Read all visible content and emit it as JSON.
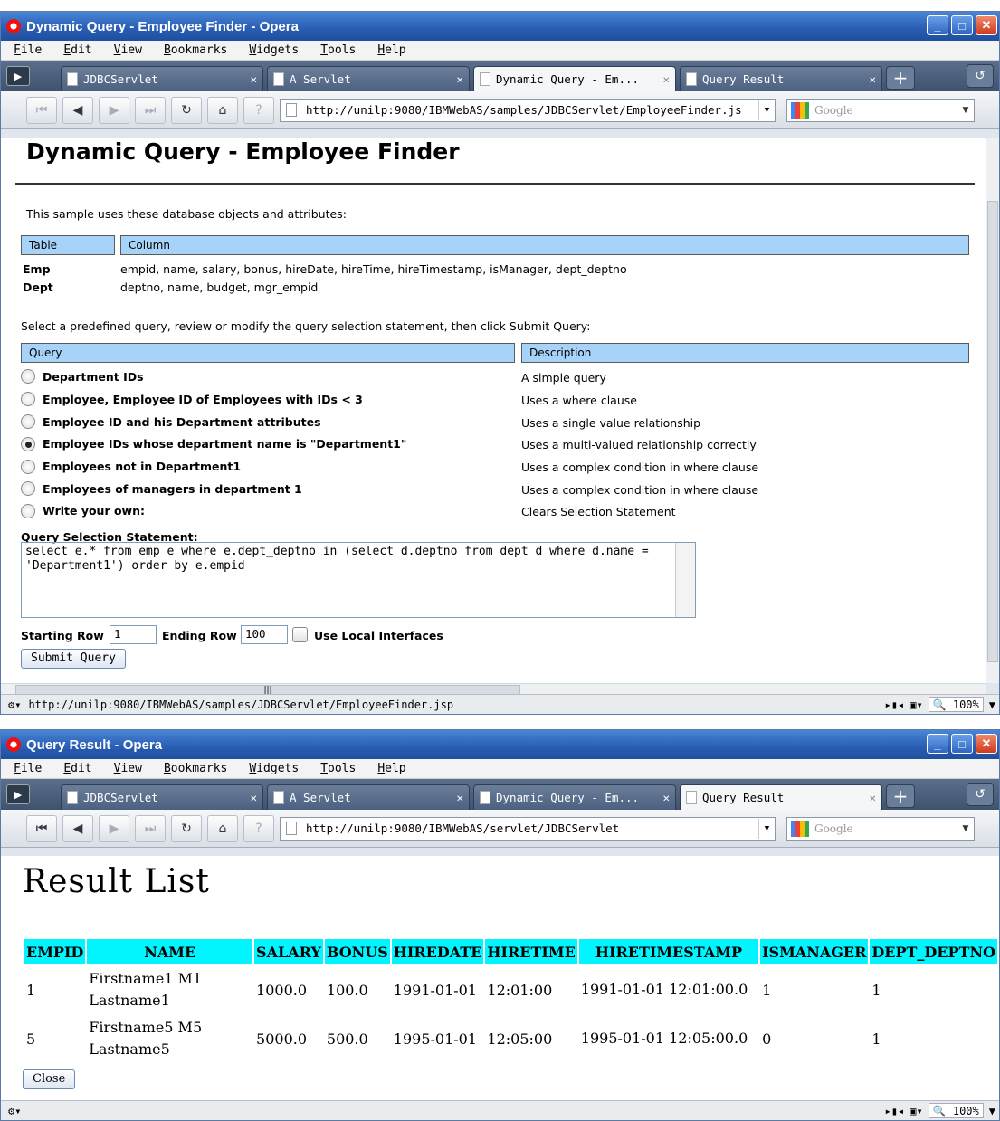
{
  "window1": {
    "title": "Dynamic Query - Employee Finder - Opera",
    "menu": [
      "File",
      "Edit",
      "View",
      "Bookmarks",
      "Widgets",
      "Tools",
      "Help"
    ],
    "tabs": [
      "JDBCServlet",
      "A Servlet",
      "Dynamic Query - Em...",
      "Query Result"
    ],
    "address": "http://unilp:9080/IBMWebAS/samples/JDBCServlet/EmployeeFinder.js",
    "search_placeholder": "Google",
    "status_url": "http://unilp:9080/IBMWebAS/samples/JDBCServlet/EmployeeFinder.jsp",
    "zoom": "100%",
    "page": {
      "heading": "Dynamic Query - Employee Finder",
      "intro": "This sample uses these database objects and attributes:",
      "table_headers": [
        "Table",
        "Column"
      ],
      "tables": [
        {
          "name": "Emp",
          "columns": "empid, name, salary, bonus, hireDate, hireTime, hireTimestamp, isManager, dept_deptno"
        },
        {
          "name": "Dept",
          "columns": "deptno, name, budget, mgr_empid"
        }
      ],
      "select_text": "Select a predefined query, review or modify the query selection statement, then click Submit Query:",
      "query_headers": [
        "Query",
        "Description"
      ],
      "queries": [
        {
          "label": "Department IDs",
          "desc": "A simple query",
          "selected": false
        },
        {
          "label": "Employee, Employee ID of Employees with IDs < 3",
          "desc": "Uses a where clause",
          "selected": false
        },
        {
          "label": "Employee ID and his Department attributes",
          "desc": "Uses a single value relationship",
          "selected": false
        },
        {
          "label": "Employee IDs whose department name is \"Department1\"",
          "desc": "Uses a multi-valued relationship correctly",
          "selected": true
        },
        {
          "label": "Employees not in Department1",
          "desc": "Uses a complex condition in where clause",
          "selected": false
        },
        {
          "label": "Employees of managers in department 1",
          "desc": "Uses a complex condition in where clause",
          "selected": false
        },
        {
          "label": "Write your own:",
          "desc": "Clears Selection Statement",
          "selected": false
        }
      ],
      "statement_label": "Query Selection Statement:",
      "statement": "select e.* from emp e where e.dept_deptno in (select d.deptno from dept d where d.name = 'Department1') order by e.empid",
      "starting_row_label": "Starting Row",
      "starting_row": "1",
      "ending_row_label": "Ending Row",
      "ending_row": "100",
      "local_label": "Use Local Interfaces",
      "submit": "Submit Query"
    }
  },
  "window2": {
    "title": "Query Result - Opera",
    "menu": [
      "File",
      "Edit",
      "View",
      "Bookmarks",
      "Widgets",
      "Tools",
      "Help"
    ],
    "tabs": [
      "JDBCServlet",
      "A Servlet",
      "Dynamic Query - Em...",
      "Query Result"
    ],
    "address": "http://unilp:9080/IBMWebAS/servlet/JDBCServlet",
    "search_placeholder": "Google",
    "zoom": "100%",
    "page": {
      "heading": "Result List",
      "columns": [
        "EMPID",
        "NAME",
        "SALARY",
        "BONUS",
        "HIREDATE",
        "HIRETIME",
        "HIRETIMESTAMP",
        "ISMANAGER",
        "DEPT_DEPTNO"
      ],
      "rows": [
        [
          "1",
          "Firstname1 M1 Lastname1",
          "1000.0",
          "100.0",
          "1991-01-01",
          "12:01:00",
          "1991-01-01 12:01:00.0",
          "1",
          "1"
        ],
        [
          "5",
          "Firstname5 M5 Lastname5",
          "5000.0",
          "500.0",
          "1995-01-01",
          "12:05:00",
          "1995-01-01 12:05:00.0",
          "0",
          "1"
        ]
      ],
      "close": "Close"
    }
  }
}
